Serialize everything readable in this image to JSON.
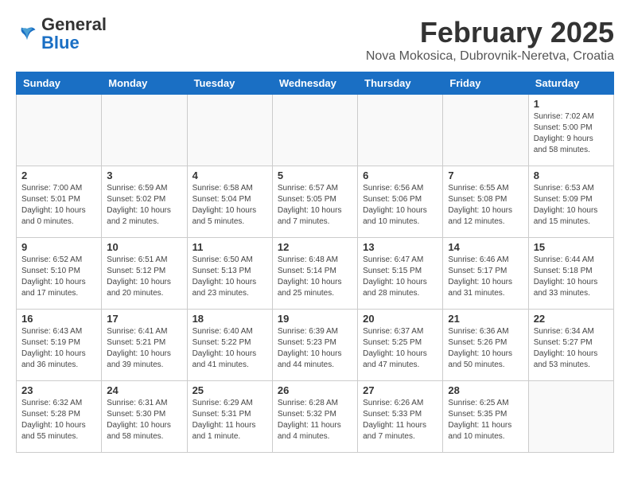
{
  "header": {
    "logo_general": "General",
    "logo_blue": "Blue",
    "month_year": "February 2025",
    "location": "Nova Mokosica, Dubrovnik-Neretva, Croatia"
  },
  "weekdays": [
    "Sunday",
    "Monday",
    "Tuesday",
    "Wednesday",
    "Thursday",
    "Friday",
    "Saturday"
  ],
  "weeks": [
    [
      {
        "day": "",
        "info": ""
      },
      {
        "day": "",
        "info": ""
      },
      {
        "day": "",
        "info": ""
      },
      {
        "day": "",
        "info": ""
      },
      {
        "day": "",
        "info": ""
      },
      {
        "day": "",
        "info": ""
      },
      {
        "day": "1",
        "info": "Sunrise: 7:02 AM\nSunset: 5:00 PM\nDaylight: 9 hours\nand 58 minutes."
      }
    ],
    [
      {
        "day": "2",
        "info": "Sunrise: 7:00 AM\nSunset: 5:01 PM\nDaylight: 10 hours\nand 0 minutes."
      },
      {
        "day": "3",
        "info": "Sunrise: 6:59 AM\nSunset: 5:02 PM\nDaylight: 10 hours\nand 2 minutes."
      },
      {
        "day": "4",
        "info": "Sunrise: 6:58 AM\nSunset: 5:04 PM\nDaylight: 10 hours\nand 5 minutes."
      },
      {
        "day": "5",
        "info": "Sunrise: 6:57 AM\nSunset: 5:05 PM\nDaylight: 10 hours\nand 7 minutes."
      },
      {
        "day": "6",
        "info": "Sunrise: 6:56 AM\nSunset: 5:06 PM\nDaylight: 10 hours\nand 10 minutes."
      },
      {
        "day": "7",
        "info": "Sunrise: 6:55 AM\nSunset: 5:08 PM\nDaylight: 10 hours\nand 12 minutes."
      },
      {
        "day": "8",
        "info": "Sunrise: 6:53 AM\nSunset: 5:09 PM\nDaylight: 10 hours\nand 15 minutes."
      }
    ],
    [
      {
        "day": "9",
        "info": "Sunrise: 6:52 AM\nSunset: 5:10 PM\nDaylight: 10 hours\nand 17 minutes."
      },
      {
        "day": "10",
        "info": "Sunrise: 6:51 AM\nSunset: 5:12 PM\nDaylight: 10 hours\nand 20 minutes."
      },
      {
        "day": "11",
        "info": "Sunrise: 6:50 AM\nSunset: 5:13 PM\nDaylight: 10 hours\nand 23 minutes."
      },
      {
        "day": "12",
        "info": "Sunrise: 6:48 AM\nSunset: 5:14 PM\nDaylight: 10 hours\nand 25 minutes."
      },
      {
        "day": "13",
        "info": "Sunrise: 6:47 AM\nSunset: 5:15 PM\nDaylight: 10 hours\nand 28 minutes."
      },
      {
        "day": "14",
        "info": "Sunrise: 6:46 AM\nSunset: 5:17 PM\nDaylight: 10 hours\nand 31 minutes."
      },
      {
        "day": "15",
        "info": "Sunrise: 6:44 AM\nSunset: 5:18 PM\nDaylight: 10 hours\nand 33 minutes."
      }
    ],
    [
      {
        "day": "16",
        "info": "Sunrise: 6:43 AM\nSunset: 5:19 PM\nDaylight: 10 hours\nand 36 minutes."
      },
      {
        "day": "17",
        "info": "Sunrise: 6:41 AM\nSunset: 5:21 PM\nDaylight: 10 hours\nand 39 minutes."
      },
      {
        "day": "18",
        "info": "Sunrise: 6:40 AM\nSunset: 5:22 PM\nDaylight: 10 hours\nand 41 minutes."
      },
      {
        "day": "19",
        "info": "Sunrise: 6:39 AM\nSunset: 5:23 PM\nDaylight: 10 hours\nand 44 minutes."
      },
      {
        "day": "20",
        "info": "Sunrise: 6:37 AM\nSunset: 5:25 PM\nDaylight: 10 hours\nand 47 minutes."
      },
      {
        "day": "21",
        "info": "Sunrise: 6:36 AM\nSunset: 5:26 PM\nDaylight: 10 hours\nand 50 minutes."
      },
      {
        "day": "22",
        "info": "Sunrise: 6:34 AM\nSunset: 5:27 PM\nDaylight: 10 hours\nand 53 minutes."
      }
    ],
    [
      {
        "day": "23",
        "info": "Sunrise: 6:32 AM\nSunset: 5:28 PM\nDaylight: 10 hours\nand 55 minutes."
      },
      {
        "day": "24",
        "info": "Sunrise: 6:31 AM\nSunset: 5:30 PM\nDaylight: 10 hours\nand 58 minutes."
      },
      {
        "day": "25",
        "info": "Sunrise: 6:29 AM\nSunset: 5:31 PM\nDaylight: 11 hours\nand 1 minute."
      },
      {
        "day": "26",
        "info": "Sunrise: 6:28 AM\nSunset: 5:32 PM\nDaylight: 11 hours\nand 4 minutes."
      },
      {
        "day": "27",
        "info": "Sunrise: 6:26 AM\nSunset: 5:33 PM\nDaylight: 11 hours\nand 7 minutes."
      },
      {
        "day": "28",
        "info": "Sunrise: 6:25 AM\nSunset: 5:35 PM\nDaylight: 11 hours\nand 10 minutes."
      },
      {
        "day": "",
        "info": ""
      }
    ]
  ]
}
